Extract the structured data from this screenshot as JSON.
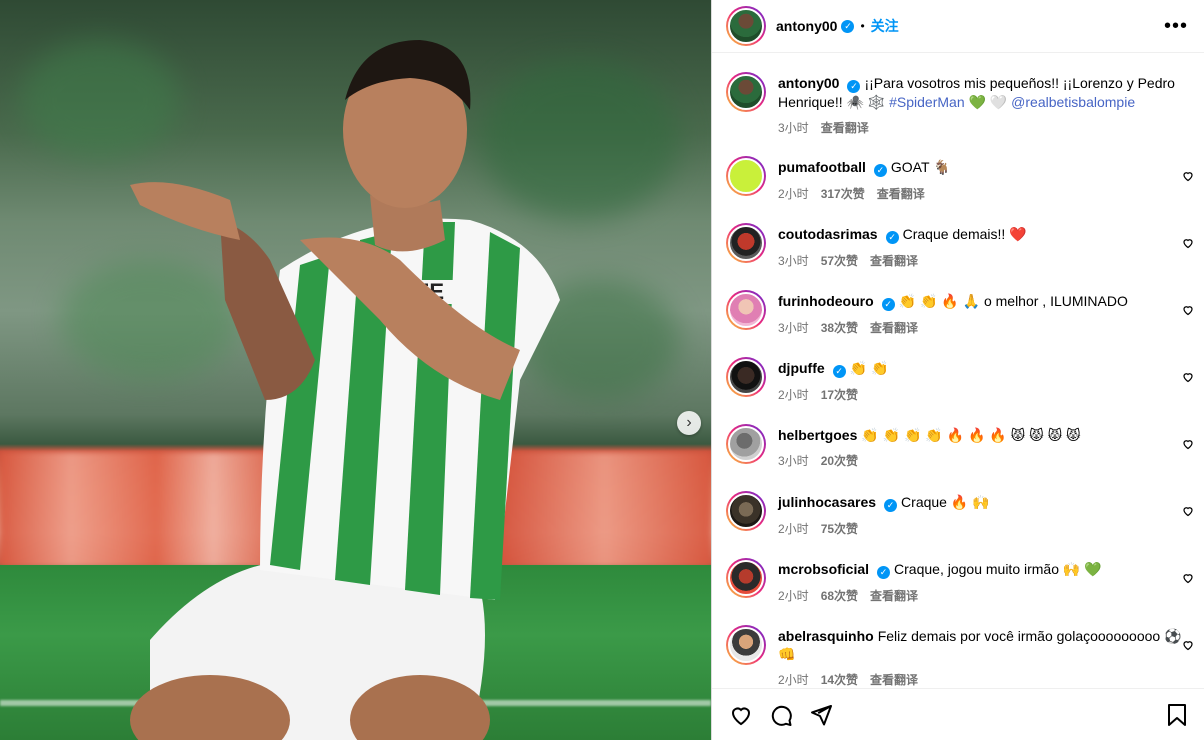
{
  "post": {
    "author": "antony00",
    "follow_label": "关注",
    "more_label": "•••",
    "photo_alt": "",
    "next_label": "›"
  },
  "caption": {
    "username": "antony00",
    "text": "¡¡Para vosotros mis pequeños!! ¡¡Lorenzo y Pedro Henrique!! 🕷️ 🕸️ ",
    "hashtag": "#SpiderMan",
    "after_hashtag": " 💚 🤍 ",
    "mention": "@realbetisbalompie",
    "time": "3小时",
    "translate": "查看翻译"
  },
  "comments": [
    {
      "username": "pumafootball",
      "verified": true,
      "text": "GOAT 🐐",
      "time": "2小时",
      "likes": "317次赞",
      "translate": "查看翻译",
      "avatar": "av-puma"
    },
    {
      "username": "coutodasrimas",
      "verified": true,
      "text": "Craque demais!! ❤️",
      "time": "3小时",
      "likes": "57次赞",
      "translate": "查看翻译",
      "avatar": "av-couto"
    },
    {
      "username": "furinhodeouro",
      "verified": true,
      "text": "👏 👏 🔥 🙏 o melhor , ILUMINADO",
      "time": "3小时",
      "likes": "38次赞",
      "translate": "查看翻译",
      "avatar": "av-furi"
    },
    {
      "username": "djpuffe",
      "verified": true,
      "text": "👏 👏",
      "time": "2小时",
      "likes": "17次赞",
      "translate": "",
      "avatar": "av-dj"
    },
    {
      "username": "helbertgoes",
      "verified": false,
      "text": "👏 👏 👏 👏 🔥 🔥 🔥 😾 😾 😾 😾",
      "time": "3小时",
      "likes": "20次赞",
      "translate": "",
      "avatar": "av-hel"
    },
    {
      "username": "julinhocasares",
      "verified": true,
      "text": "Craque 🔥 🙌",
      "time": "2小时",
      "likes": "75次赞",
      "translate": "",
      "avatar": "av-jul"
    },
    {
      "username": "mcrobsoficial",
      "verified": true,
      "text": "Craque, jogou muito irmão 🙌 💚",
      "time": "2小时",
      "likes": "68次赞",
      "translate": "查看翻译",
      "avatar": "av-mc"
    },
    {
      "username": "abelrasquinho",
      "verified": false,
      "text": "Feliz demais por você irmão golaçooooooooo ⚽ 👊",
      "time": "2小时",
      "likes": "14次赞",
      "translate": "查看翻译",
      "avatar": "av-abel"
    }
  ],
  "icons": {
    "like": "heart-icon",
    "comment": "comment-icon",
    "share": "share-icon",
    "save": "bookmark-icon"
  },
  "colors": {
    "accent": "#0095f6",
    "text": "#000000",
    "muted": "#737373"
  }
}
